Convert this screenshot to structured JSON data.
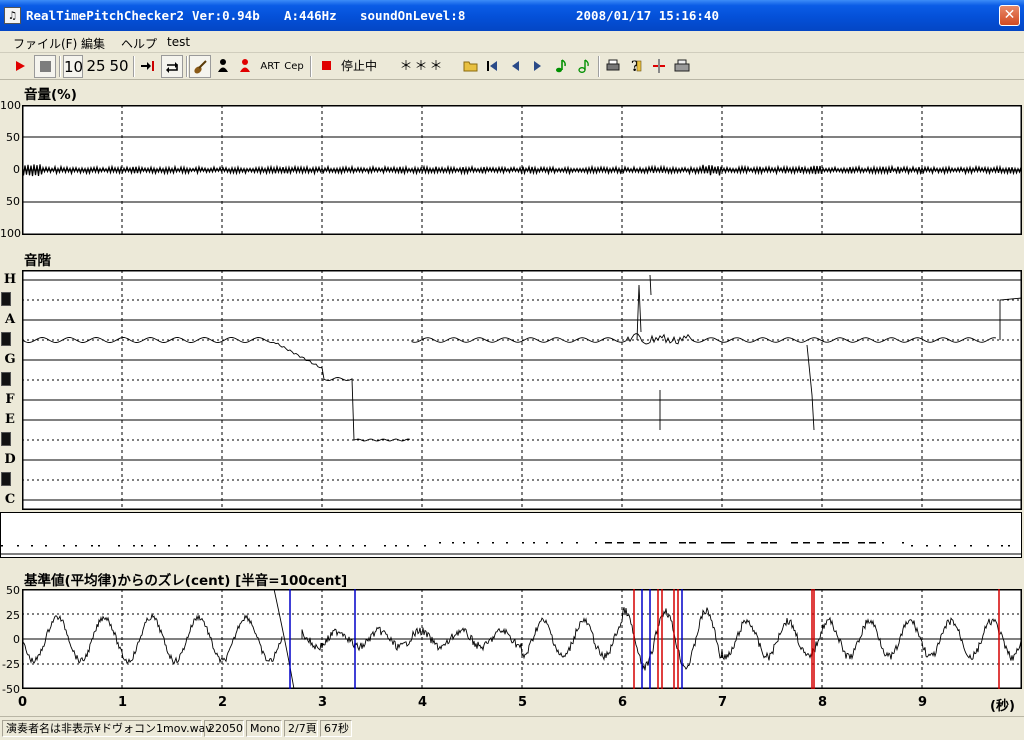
{
  "window": {
    "app_name": "RealTimePitchChecker2",
    "version": "Ver:0.94b",
    "a_freq": "A:446Hz",
    "sound_on_level": "soundOnLevel:8",
    "datetime": "2008/01/17 15:16:40",
    "close_glyph": "✕"
  },
  "menu": {
    "file": "ファイル(F)",
    "edit": "編集",
    "help": "ヘルプ",
    "test": "test"
  },
  "toolbar": {
    "n10": "10",
    "n25": "25",
    "n50": "50",
    "art": "ART",
    "cep": "Cep",
    "status": "停止中",
    "pitch_display": "＊＊＊",
    "icons": [
      "play-icon",
      "stop-icon",
      "skip-end-icon",
      "loop-icon",
      "instrument-icon",
      "person-black-icon",
      "person-red-icon",
      "record-icon",
      "folder-open-icon",
      "first-icon",
      "prev-icon",
      "next-icon",
      "note-green-icon",
      "note-outline-icon",
      "print-icon",
      "help-icon",
      "marker-icon",
      "printer-icon"
    ]
  },
  "volume_panel": {
    "title": "音量(%)",
    "y_ticks": [
      "100",
      "50",
      "0",
      "50",
      "100"
    ]
  },
  "scale_panel": {
    "title": "音階",
    "notes": [
      "H",
      "A",
      "G",
      "F",
      "E",
      "D",
      "C"
    ]
  },
  "cent_panel": {
    "title": "基準値(平均律)からのズレ(cent) [半音=100cent]",
    "y_ticks": [
      "50",
      "25",
      "0",
      "-25",
      "-50"
    ]
  },
  "x_axis": {
    "ticks": [
      "0",
      "1",
      "2",
      "3",
      "4",
      "5",
      "6",
      "7",
      "8",
      "9"
    ],
    "unit": "(秒)"
  },
  "status": {
    "file": "演奏者名は非表示¥ドヴォコン1mov.wav",
    "rate": "22050",
    "channels": "Mono",
    "page": "2/7頁",
    "duration": "67秒"
  },
  "colors": {
    "titlebar": "#0450d8",
    "record": "#e00000",
    "cent_red": "#d40000",
    "cent_blue": "#0000c8"
  }
}
